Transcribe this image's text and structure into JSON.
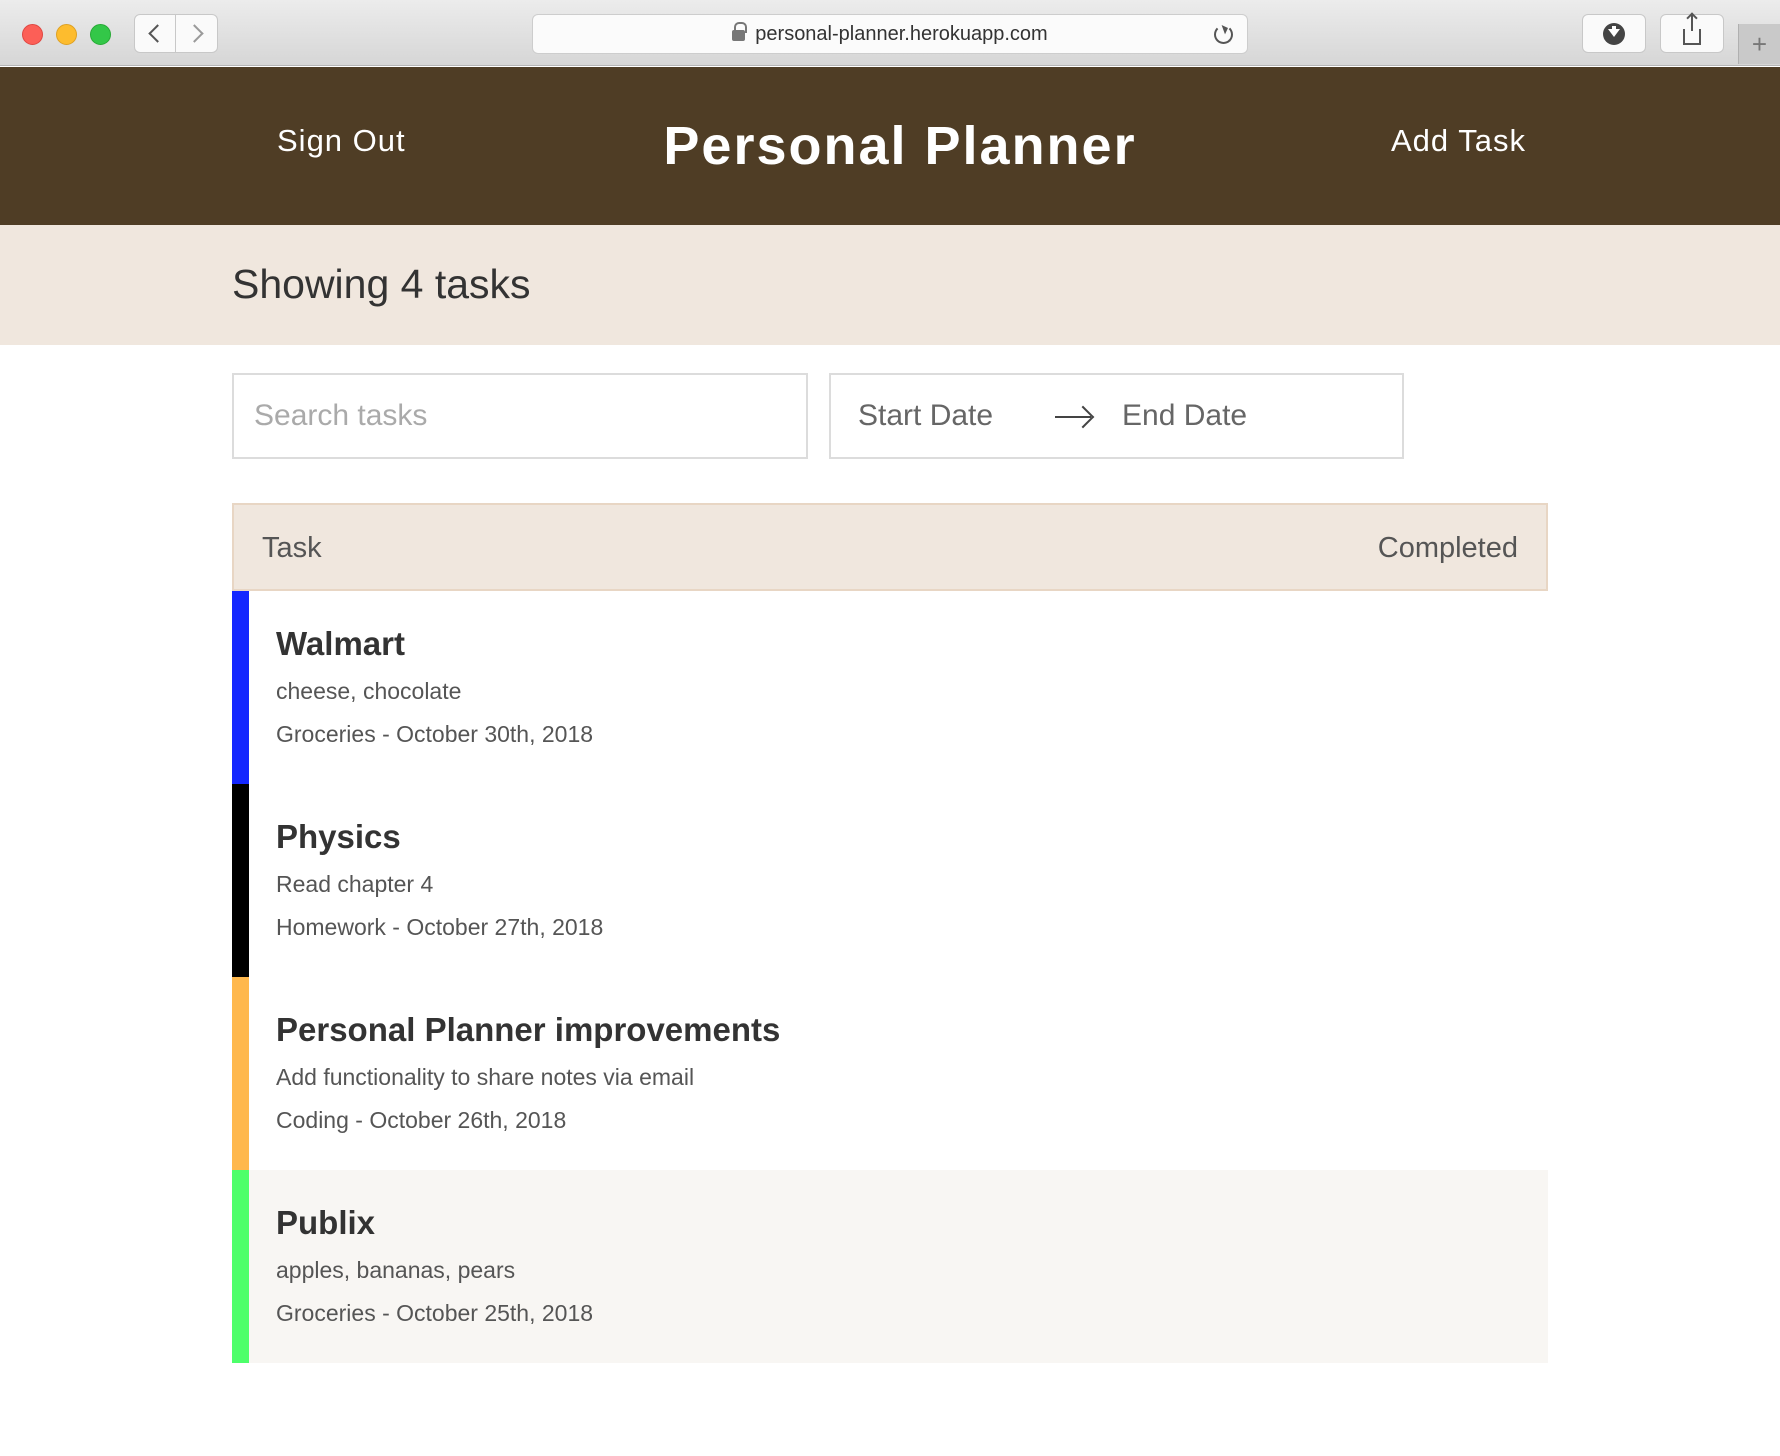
{
  "browser": {
    "url": "personal-planner.herokuapp.com"
  },
  "header": {
    "sign_out_label": "Sign Out",
    "title": "Personal Planner",
    "add_task_label": "Add Task",
    "background_color": "#4f3d25"
  },
  "summary": {
    "showing_text": "Showing 4 tasks"
  },
  "filters": {
    "search_placeholder": "Search tasks",
    "search_value": "",
    "start_date_placeholder": "Start Date",
    "end_date_placeholder": "End Date"
  },
  "table": {
    "columns": [
      "Task",
      "Completed"
    ],
    "rows": [
      {
        "title": "Walmart",
        "note": "cheese, chocolate",
        "meta": "Groceries - October 30th, 2018",
        "color": "#1427ff",
        "completed": false
      },
      {
        "title": "Physics",
        "note": "Read chapter 4",
        "meta": "Homework - October 27th, 2018",
        "color": "#000000",
        "completed": false
      },
      {
        "title": "Personal Planner improvements",
        "note": "Add functionality to share notes via email",
        "meta": "Coding - October 26th, 2018",
        "color": "#ffb84d",
        "completed": false
      },
      {
        "title": "Publix",
        "note": "apples, bananas, pears",
        "meta": "Groceries - October 25th, 2018",
        "color": "#4dff6a",
        "completed": false
      }
    ]
  },
  "icons": [
    "lock-icon",
    "reload-icon",
    "download-icon",
    "share-icon",
    "arrow-right-icon",
    "back-icon",
    "forward-icon",
    "new-tab-icon"
  ]
}
